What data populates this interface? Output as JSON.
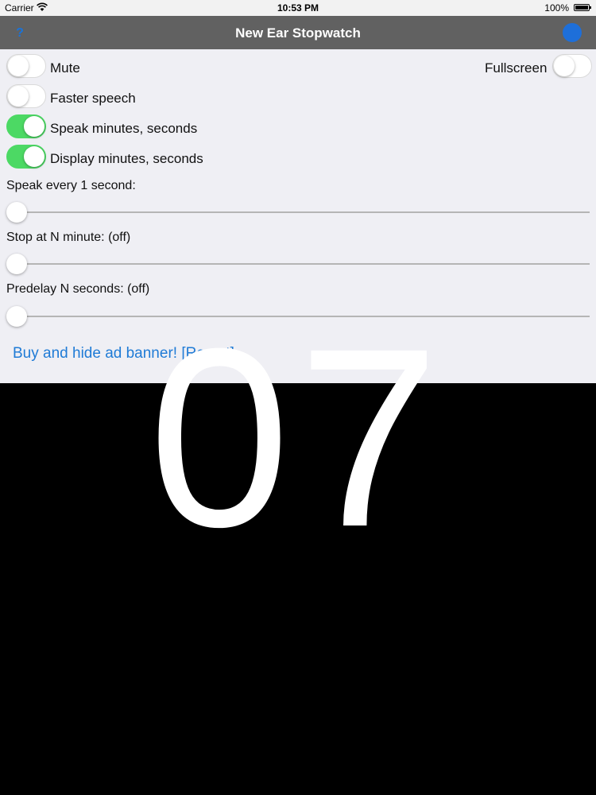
{
  "status_bar": {
    "carrier": "Carrier",
    "time": "10:53 PM",
    "battery": "100%"
  },
  "nav": {
    "title": "New Ear Stopwatch",
    "help_label": "?",
    "accent_color": "#1e6fd9"
  },
  "toggles": {
    "mute": {
      "label": "Mute",
      "on": false
    },
    "fullscreen": {
      "label": "Fullscreen",
      "on": false
    },
    "faster_speech": {
      "label": "Faster speech",
      "on": false
    },
    "speak_min_sec": {
      "label": "Speak minutes, seconds",
      "on": true
    },
    "display_min_sec": {
      "label": "Display minutes, seconds",
      "on": true
    }
  },
  "sliders": {
    "speak_every": {
      "label": "Speak every 1 second:",
      "value": 0
    },
    "stop_at": {
      "label": "Stop at N minute: (off)",
      "value": 0
    },
    "predelay": {
      "label": "Predelay N seconds: (off)",
      "value": 0
    }
  },
  "buy_link": "Buy and hide ad banner! [Revert]",
  "timer": "07",
  "colors": {
    "toggle_on": "#4cd964",
    "link": "#1f7bd6"
  }
}
